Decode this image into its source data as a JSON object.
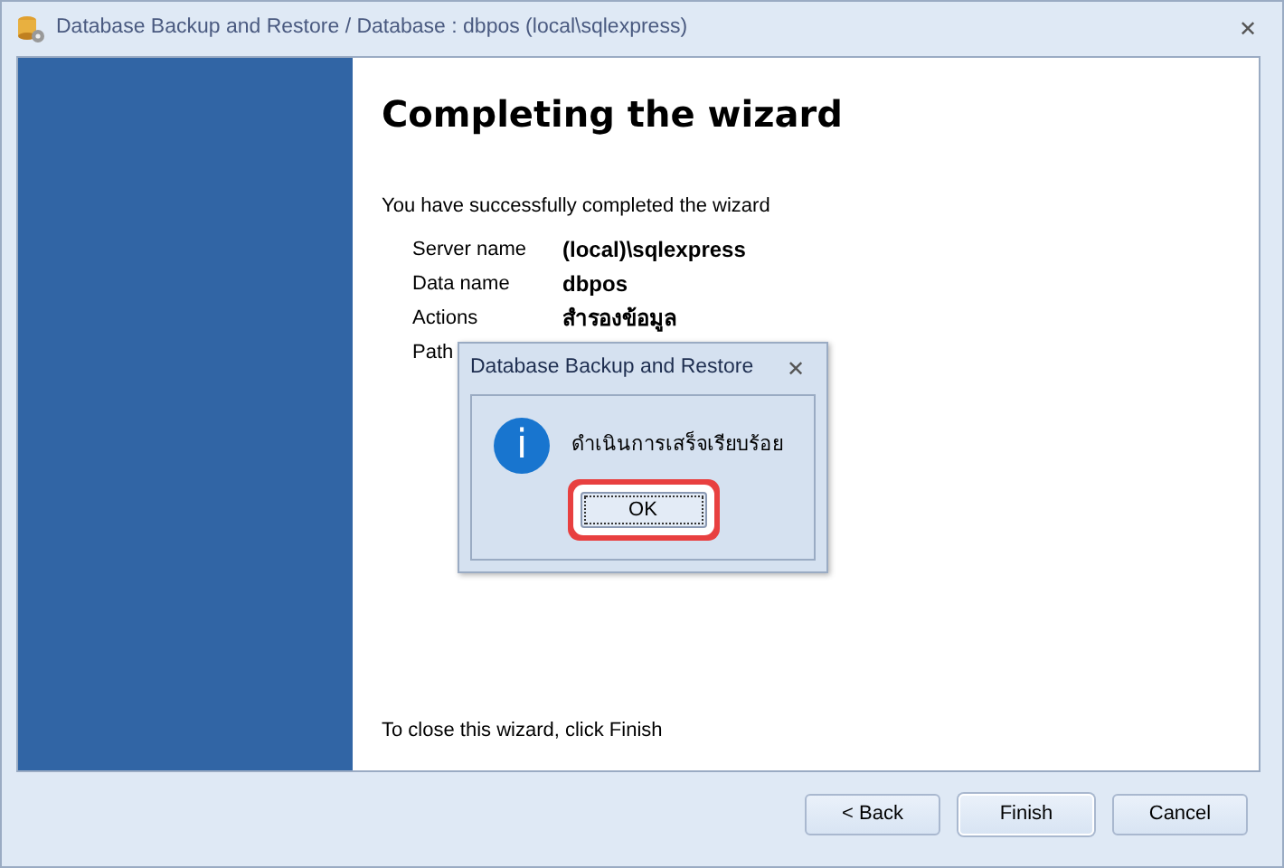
{
  "window": {
    "title": "Database Backup and Restore / Database : dbpos (local\\sqlexpress)",
    "close": "✕"
  },
  "wizard": {
    "heading": "Completing the wizard",
    "intro": "You have successfully completed the wizard",
    "details": [
      {
        "label": "Server name",
        "value": "(local)\\sqlexpress"
      },
      {
        "label": "Data name",
        "value": "dbpos"
      },
      {
        "label": "Actions",
        "value": "สำรองข้อมูล"
      },
      {
        "label": "Path"
      }
    ],
    "footer_note": "To close this wizard, click Finish"
  },
  "buttons": [
    {
      "label": "< Back",
      "focused": false
    },
    {
      "label": "Finish",
      "focused": true
    },
    {
      "label": "Cancel",
      "focused": false
    }
  ],
  "dialog": {
    "title": "Database Backup and Restore",
    "close": "✕",
    "icon_letter": "i",
    "message": "ดำเนินการเสร็จเรียบร้อย",
    "button": {
      "label": "OK",
      "highlighted": true
    }
  }
}
